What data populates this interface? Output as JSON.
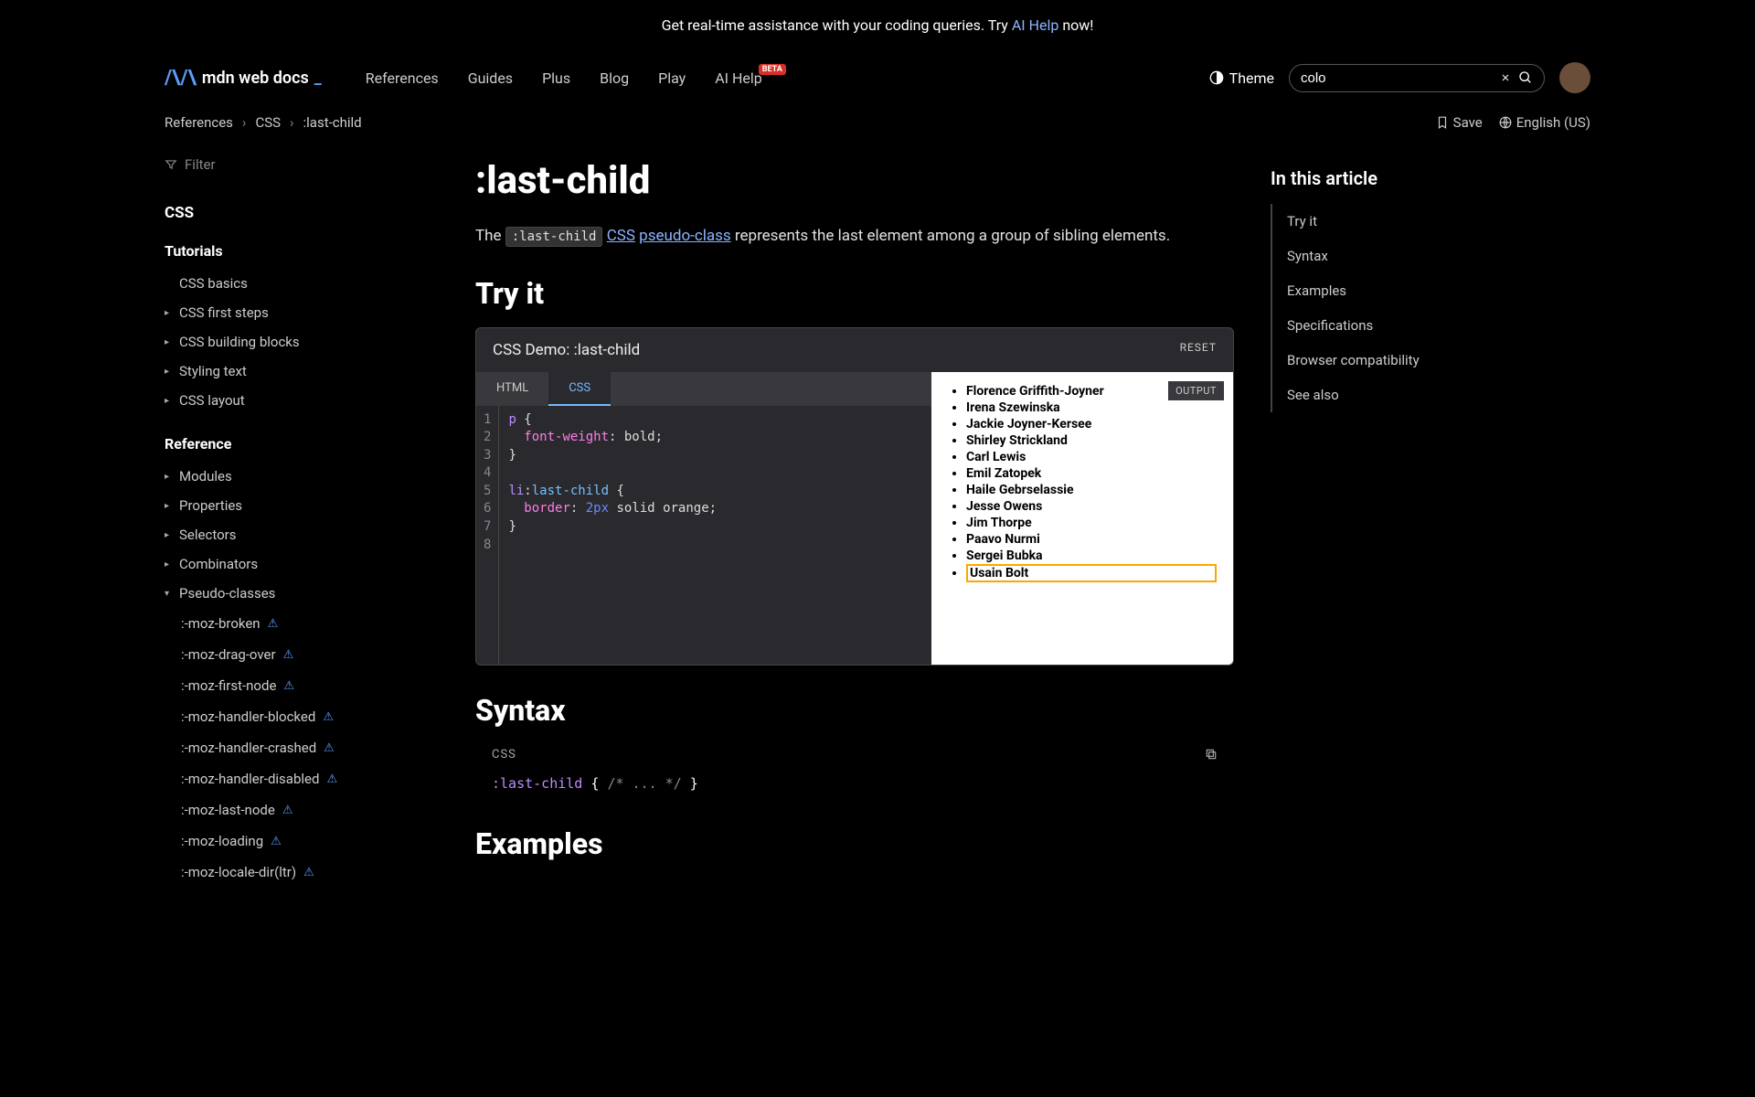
{
  "banner": {
    "pre": "Get real-time assistance with your coding queries. Try ",
    "link": "AI Help",
    "post": " now!"
  },
  "header": {
    "logo_text": "mdn web docs",
    "nav": [
      "References",
      "Guides",
      "Plus",
      "Blog",
      "Play"
    ],
    "ai_help": "AI Help",
    "beta": "BETA",
    "theme": "Theme",
    "search_value": "colo"
  },
  "breadcrumbs": [
    "References",
    "CSS",
    ":last-child"
  ],
  "actions": {
    "save": "Save",
    "lang": "English (US)"
  },
  "sidebar": {
    "filter": "Filter",
    "title1": "CSS",
    "title2": "Tutorials",
    "tut_items": [
      "CSS basics",
      "CSS first steps",
      "CSS building blocks",
      "Styling text",
      "CSS layout"
    ],
    "title3": "Reference",
    "ref_items": [
      "Modules",
      "Properties",
      "Selectors",
      "Combinators",
      "Pseudo-classes"
    ],
    "pseudo": [
      ":-moz-broken",
      ":-moz-drag-over",
      ":-moz-first-node",
      ":-moz-handler-blocked",
      ":-moz-handler-crashed",
      ":-moz-handler-disabled",
      ":-moz-last-node",
      ":-moz-loading",
      ":-moz-locale-dir(ltr)"
    ]
  },
  "page": {
    "h1": ":last-child",
    "intro_pre": "The ",
    "intro_code": ":last-child",
    "intro_link1": "CSS",
    "intro_link2": "pseudo-class",
    "intro_post": " represents the last element among a group of sibling elements.",
    "tryit": "Try it",
    "demo_title": "CSS Demo: :last-child",
    "reset": "RESET",
    "tabs": [
      "HTML",
      "CSS"
    ],
    "output": "OUTPUT",
    "athletes": [
      "Florence Griffith-Joyner",
      "Irena Szewinska",
      "Jackie Joyner-Kersee",
      "Shirley Strickland",
      "Carl Lewis",
      "Emil Zatopek",
      "Haile Gebrselassie",
      "Jesse Owens",
      "Jim Thorpe",
      "Paavo Nurmi",
      "Sergei Bubka",
      "Usain Bolt"
    ],
    "syntax": "Syntax",
    "syntax_label": "CSS",
    "syntax_line1": ":last-child",
    "syntax_line2": "/* ... */",
    "examples": "Examples",
    "code": {
      "p": "p",
      "fw": "font-weight",
      "bold": "bold",
      "li": "li",
      "lc": "last-child",
      "border": "border",
      "tpx": "2px",
      "solid": "solid",
      "orange": "orange"
    }
  },
  "toc": {
    "title": "In this article",
    "items": [
      "Try it",
      "Syntax",
      "Examples",
      "Specifications",
      "Browser compatibility",
      "See also"
    ]
  }
}
